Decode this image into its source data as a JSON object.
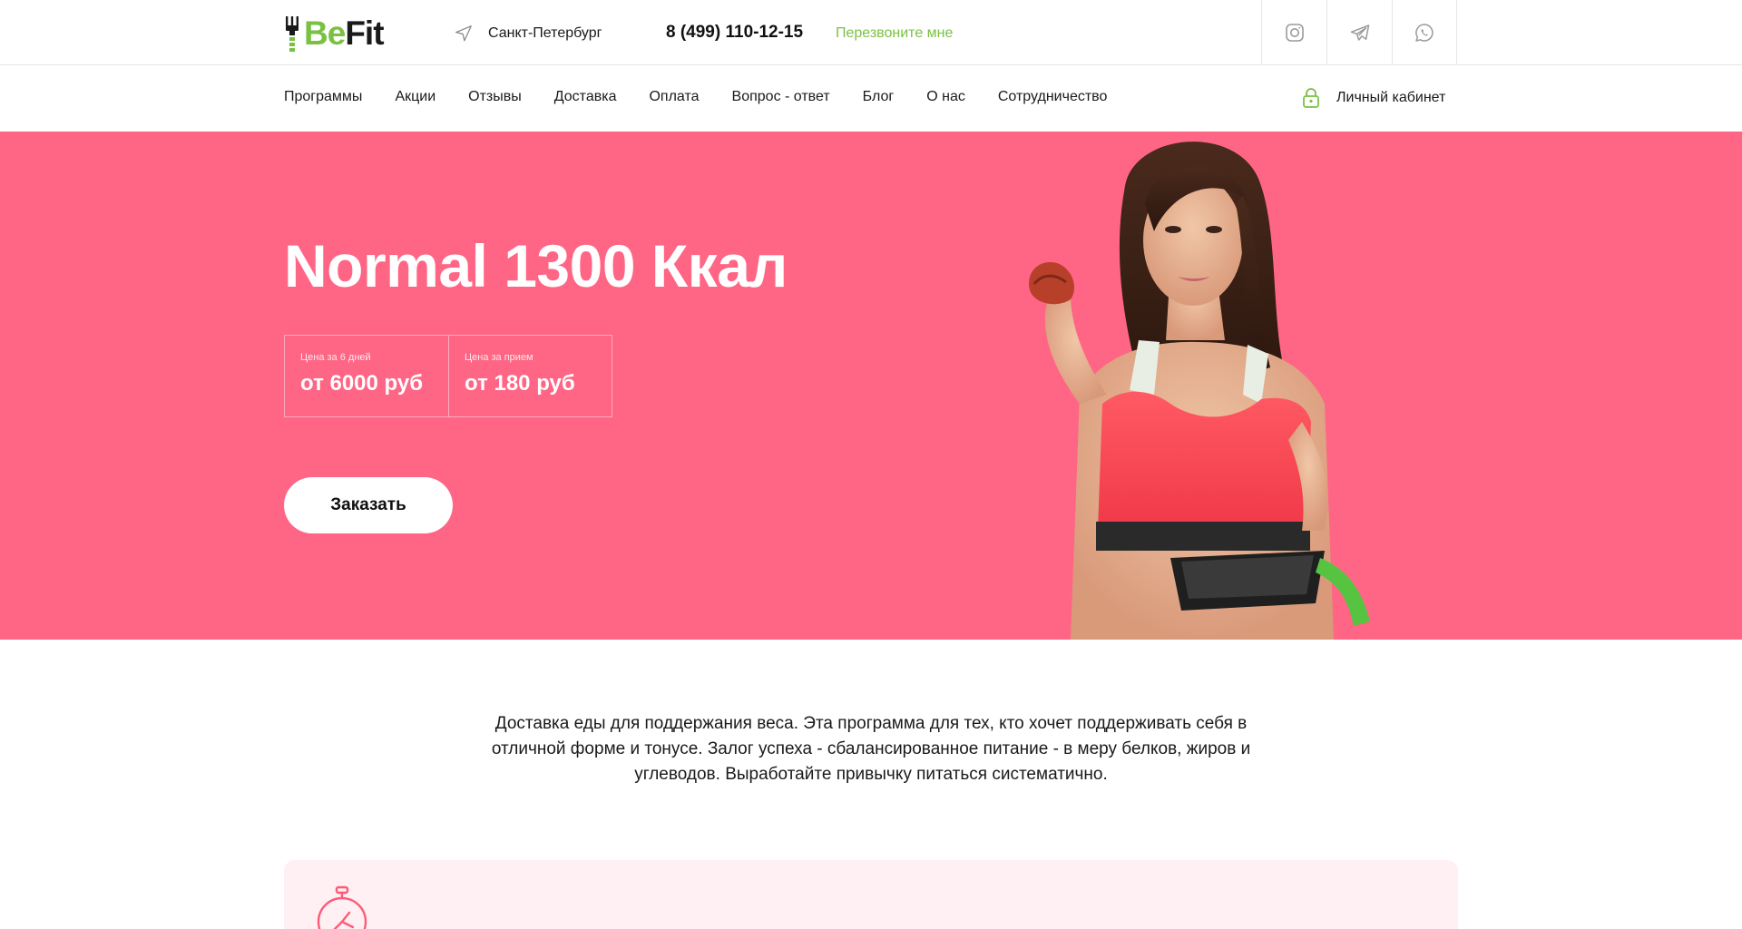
{
  "brand": {
    "be": "Be",
    "fit": "Fit",
    "green": "#7ac143"
  },
  "header": {
    "city": "Санкт-Петербург",
    "phone": "8 (499) 110-12-15",
    "callback": "Перезвоните мне",
    "socials": [
      "instagram-icon",
      "telegram-icon",
      "whatsapp-icon"
    ]
  },
  "nav": {
    "items": [
      "Программы",
      "Акции",
      "Отзывы",
      "Доставка",
      "Оплата",
      "Вопрос - ответ",
      "Блог",
      "О нас",
      "Сотрудничество"
    ],
    "cabinet": "Личный кабинет"
  },
  "hero": {
    "title": "Normal 1300 Ккал",
    "background": "#ff6685",
    "prices": [
      {
        "caption": "Цена за 6 дней",
        "value": "от 6000 руб"
      },
      {
        "caption": "Цена за прием",
        "value": "от 180 руб"
      }
    ],
    "order_label": "Заказать"
  },
  "description": "Доставка еды для поддержания веса. Эта программа для тех, кто хочет поддерживать себя в отличной форме и тонусе. Залог успеха - сбалансированное питание - в меру белков, жиров и углеводов. Выработайте привычку питаться систематично.",
  "card": {
    "icon": "stopwatch-icon"
  }
}
